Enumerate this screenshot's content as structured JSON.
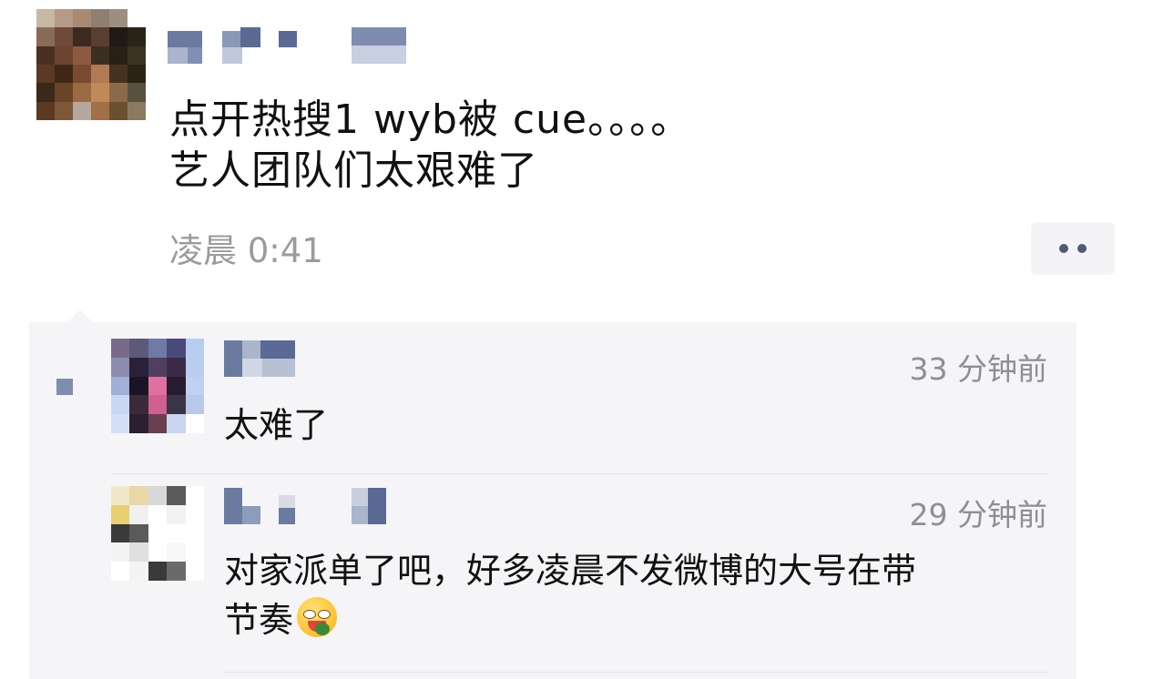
{
  "post": {
    "avatar_colors": [
      "#c7b8a6",
      "#b59a88",
      "#a88a73",
      "#8f7f70",
      "#9d8f80",
      "#ffffff",
      "#8a6b57",
      "#6e4a3a",
      "#3b2a20",
      "#5a3f30",
      "#1e1a14",
      "#2a2418",
      "#4a3020",
      "#6b4530",
      "#8c5a40",
      "#3d2e22",
      "#2a1f16",
      "#3c3320",
      "#5a3a24",
      "#3d2818",
      "#7a4a30",
      "#b07a52",
      "#463220",
      "#2b2416",
      "#3a2818",
      "#6a4428",
      "#9a6a40",
      "#c08a58",
      "#8a6a48",
      "#5a5040",
      "#5c3a22",
      "#7a5838",
      "#b5a8a0",
      "#a07048",
      "#6a5030",
      "#8a7a60"
    ],
    "text_lines": [
      "点开热搜1 wyb被 cue。。。。",
      "艺人团队们太艰难了"
    ],
    "time": "凌晨 0:41"
  },
  "more_button": {
    "icon": "more-dots-icon"
  },
  "comments": [
    {
      "avatar_colors": [
        "#7a6a8a",
        "#5c5a7a",
        "#6e7aa8",
        "#4a4a7a",
        "#b8ccee",
        "#8c8cb0",
        "#2a2038",
        "#504060",
        "#3a2a48",
        "#b8ccee",
        "#a0b0d8",
        "#1a1424",
        "#e070a0",
        "#281a30",
        "#c0d0f0",
        "#c8d8f4",
        "#3a2a3a",
        "#d06090",
        "#3a3448",
        "#b8c8e8",
        "#d4e0f8",
        "#2a2030",
        "#6a4050",
        "#c8d4f0",
        "#ffffff"
      ],
      "time": "33 分钟前",
      "text": "太难了"
    },
    {
      "avatar_colors": [
        "#f0e8c8",
        "#e8d8a8",
        "#d8d8d8",
        "#5a5a5a",
        "#ffffff",
        "#e8d070",
        "#f0f0f0",
        "#ffffff",
        "#f2f2f2",
        "#ffffff",
        "#3a3a3a",
        "#5a5a5a",
        "#ffffff",
        "#ffffff",
        "#ffffff",
        "#f4f4f4",
        "#e0e0e0",
        "#ffffff",
        "#f8f8f8",
        "#ffffff",
        "#ffffff",
        "#f4f4f4",
        "#3a3a3a",
        "#6a6a6a",
        "#ffffff"
      ],
      "time": "29 分钟前",
      "text_line1": "对家派单了吧，好多凌晨不发微博的大号在带",
      "text_line2": "节奏",
      "emoji": "drooling-face-emoji"
    }
  ],
  "colors": {
    "mosaic_blue": "#6a7aa1",
    "mosaic_light": "#c8cfe0",
    "comment_bg": "#f5f5f7",
    "muted_text": "#9b9b9b"
  }
}
